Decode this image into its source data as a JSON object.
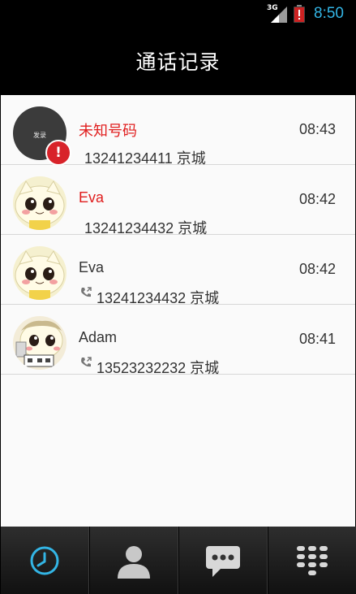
{
  "status_bar": {
    "network": "3G",
    "time": "8:50"
  },
  "header": {
    "title": "通话记录"
  },
  "calls": [
    {
      "name": "未知号码",
      "number": "13241234411  京城",
      "time": "08:43",
      "avatar": "placeholder-avatar",
      "avatar_text": "发录",
      "missed": true,
      "name_color": "#e01d1d"
    },
    {
      "name": "Eva",
      "number": "13241234432  京城",
      "time": "08:42",
      "avatar": "cat-avatar",
      "missed": false,
      "name_color": "#e01d1d"
    },
    {
      "name": "Eva",
      "number": "13241234432  京城",
      "time": "08:42",
      "avatar": "cat-avatar",
      "missed": false,
      "outgoing_icon": "outgoing-call-icon"
    },
    {
      "name": "Adam",
      "number": "13523232232  京城",
      "time": "08:41",
      "avatar": "cat-avatar-alt",
      "missed": false,
      "outgoing_icon": "outgoing-call-icon"
    }
  ],
  "tabs": [
    {
      "icon": "clock-icon",
      "active": true
    },
    {
      "icon": "contact-icon",
      "active": false
    },
    {
      "icon": "message-icon",
      "active": false
    },
    {
      "icon": "dialpad-icon",
      "active": false
    }
  ],
  "colors": {
    "accent": "#33b5e5",
    "missed": "#e01d1d",
    "badge": "#d8232a"
  }
}
